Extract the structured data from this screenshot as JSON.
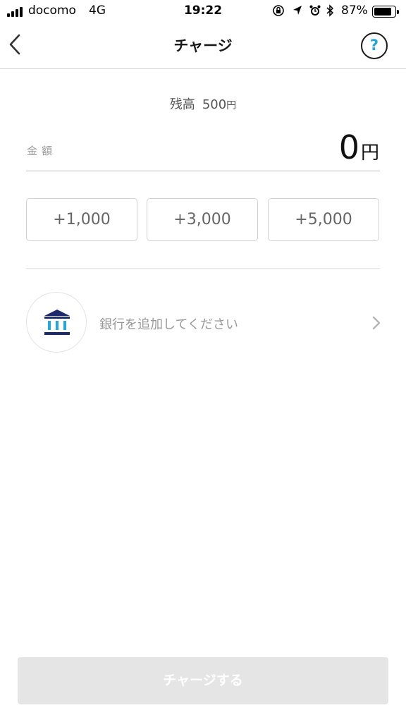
{
  "status_bar": {
    "carrier": "docomo",
    "network": "4G",
    "time": "19:22",
    "battery": "87%",
    "battery_level": 0.87
  },
  "nav": {
    "title": "チャージ",
    "help": "?"
  },
  "balance": {
    "label": "残高",
    "value": "500",
    "unit": "円"
  },
  "amount": {
    "label": "金額",
    "value": "0",
    "unit": "円"
  },
  "quick_add": [
    {
      "label": "+1,000"
    },
    {
      "label": "+3,000"
    },
    {
      "label": "+5,000"
    }
  ],
  "bank": {
    "prompt": "銀行を追加してください",
    "icon": "bank-icon",
    "icon_color": "#1a2a6c",
    "accent_color": "#1ea7e1"
  },
  "charge_button": {
    "label": "チャージする"
  }
}
